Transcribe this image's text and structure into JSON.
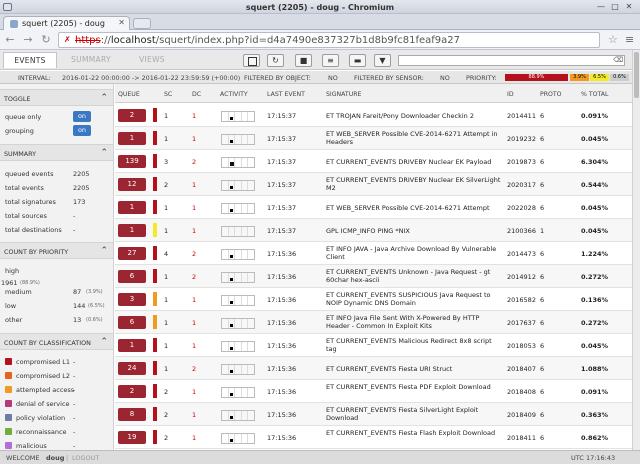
{
  "window": {
    "title": "squert (2205) - doug - Chromium"
  },
  "browser": {
    "tab_title": "squert (2205) - doug",
    "url_scheme": "https",
    "url_rest": "://",
    "url_host": "localhost",
    "url_path": "/squert/index.php?id=d4a7490e837327b1d8b9fc81feaf9a27"
  },
  "toolbar": {
    "tabs": [
      "EVENTS",
      "SUMMARY",
      "VIEWS"
    ]
  },
  "filterbar": {
    "interval_label": "INTERVAL:",
    "interval_value": "2016-01-22 00:00:00 -> 2016-01-22 23:59:59 (+00:00)",
    "filt_object_label": "FILTERED BY OBJECT:",
    "filt_object_value": "NO",
    "filt_sensor_label": "FILTERED BY SENSOR:",
    "filt_sensor_value": "NO",
    "priority_label": "PRIORITY:",
    "priority": [
      {
        "label": "88.9%",
        "color": "#b3121d"
      },
      {
        "label": "3.9%",
        "color": "#f29a1e"
      },
      {
        "label": "6.5%",
        "color": "#f3ea2a"
      },
      {
        "label": "0.6%",
        "color": "#cccccc"
      }
    ]
  },
  "sidebar": {
    "toggle": {
      "title": "TOGGLE",
      "items": [
        {
          "label": "queue only",
          "state": "on"
        },
        {
          "label": "grouping",
          "state": "on"
        }
      ]
    },
    "summary": {
      "title": "SUMMARY",
      "rows": [
        {
          "label": "queued events",
          "value": "2205"
        },
        {
          "label": "total events",
          "value": "2205"
        },
        {
          "label": "total signatures",
          "value": "173"
        },
        {
          "label": "total sources",
          "value": "-"
        },
        {
          "label": "total destinations",
          "value": "-"
        }
      ]
    },
    "priority": {
      "title": "COUNT BY PRIORITY",
      "high_label": "high",
      "high_value": "1961",
      "high_pct": "(88.9%)",
      "rows": [
        {
          "label": "medium",
          "value": "87",
          "pct": "(3.9%)"
        },
        {
          "label": "low",
          "value": "144",
          "pct": "(6.5%)"
        },
        {
          "label": "other",
          "value": "13",
          "pct": "(0.6%)"
        }
      ]
    },
    "classification": {
      "title": "COUNT BY CLASSIFICATION",
      "items": [
        {
          "label": "compromised L1",
          "value": "-",
          "color": "#b3121d"
        },
        {
          "label": "compromised L2",
          "value": "-",
          "color": "#e3651a"
        },
        {
          "label": "attempted access",
          "value": "-",
          "color": "#f29a1e"
        },
        {
          "label": "denial of service",
          "value": "-",
          "color": "#b43a7b"
        },
        {
          "label": "policy violation",
          "value": "-",
          "color": "#6e7aa8"
        },
        {
          "label": "reconnaissance",
          "value": "-",
          "color": "#6fae3a"
        },
        {
          "label": "malicious",
          "value": "-",
          "color": "#b36fd3"
        }
      ]
    }
  },
  "grid": {
    "columns": [
      "QUEUE",
      "SC",
      "DC",
      "ACTIVITY",
      "LAST EVENT",
      "SIGNATURE",
      "ID",
      "PROTO",
      "% TOTAL"
    ],
    "rows": [
      {
        "queue": "2",
        "sc": "1",
        "dc": "1",
        "last": "17:15:37",
        "sig": "ET TROJAN Fareit/Pony Downloader Checkin 2",
        "id": "2014411",
        "proto": "6",
        "pct": "0.091%",
        "color": "#b3121d"
      },
      {
        "queue": "1",
        "sc": "1",
        "dc": "1",
        "last": "17:15:37",
        "sig": "ET WEB_SERVER Possible CVE-2014-6271 Attempt in Headers",
        "id": "2019232",
        "proto": "6",
        "pct": "0.045%",
        "color": "#b3121d"
      },
      {
        "queue": "139",
        "sc": "3",
        "dc": "2",
        "last": "17:15:37",
        "sig": "ET CURRENT_EVENTS DRIVEBY Nuclear EK Payload",
        "id": "2019873",
        "proto": "6",
        "pct": "6.304%",
        "color": "#b3121d"
      },
      {
        "queue": "12",
        "sc": "2",
        "dc": "1",
        "last": "17:15:37",
        "sig": "ET CURRENT_EVENTS DRIVEBY Nuclear EK SilverLight M2",
        "id": "2020317",
        "proto": "6",
        "pct": "0.544%",
        "color": "#b3121d"
      },
      {
        "queue": "1",
        "sc": "1",
        "dc": "1",
        "last": "17:15:37",
        "sig": "ET WEB_SERVER Possible CVE-2014-6271 Attempt",
        "id": "2022028",
        "proto": "6",
        "pct": "0.045%",
        "color": "#b3121d"
      },
      {
        "queue": "1",
        "sc": "1",
        "dc": "1",
        "last": "17:15:37",
        "sig": "GPL ICMP_INFO PING *NIX",
        "id": "2100366",
        "proto": "1",
        "pct": "0.045%",
        "color": "#f3ea2a"
      },
      {
        "queue": "27",
        "sc": "4",
        "dc": "2",
        "last": "17:15:36",
        "sig": "ET INFO JAVA - Java Archive Download By Vulnerable Client",
        "id": "2014473",
        "proto": "6",
        "pct": "1.224%",
        "color": "#b3121d"
      },
      {
        "queue": "6",
        "sc": "1",
        "dc": "2",
        "last": "17:15:36",
        "sig": "ET CURRENT_EVENTS Unknown - Java Request - gt 60char hex-ascii",
        "id": "2014912",
        "proto": "6",
        "pct": "0.272%",
        "color": "#b3121d"
      },
      {
        "queue": "3",
        "sc": "1",
        "dc": "1",
        "last": "17:15:36",
        "sig": "ET CURRENT_EVENTS SUSPICIOUS Java Request to NOIP Dynamic DNS Domain",
        "id": "2016582",
        "proto": "6",
        "pct": "0.136%",
        "color": "#f29a1e"
      },
      {
        "queue": "6",
        "sc": "1",
        "dc": "1",
        "last": "17:15:36",
        "sig": "ET INFO Java File Sent With X-Powered By HTTP Header - Common In Exploit Kits",
        "id": "2017637",
        "proto": "6",
        "pct": "0.272%",
        "color": "#f29a1e"
      },
      {
        "queue": "1",
        "sc": "1",
        "dc": "1",
        "last": "17:15:36",
        "sig": "ET CURRENT_EVENTS Malicious Redirect 8x8 script tag",
        "id": "2018053",
        "proto": "6",
        "pct": "0.045%",
        "color": "#b3121d"
      },
      {
        "queue": "24",
        "sc": "1",
        "dc": "2",
        "last": "17:15:36",
        "sig": "ET CURRENT_EVENTS Fiesta URI Struct",
        "id": "2018407",
        "proto": "6",
        "pct": "1.088%",
        "color": "#b3121d"
      },
      {
        "queue": "2",
        "sc": "2",
        "dc": "1",
        "last": "17:15:36",
        "sig": "ET CURRENT_EVENTS Fiesta PDF Exploit Download",
        "id": "2018408",
        "proto": "6",
        "pct": "0.091%",
        "color": "#b3121d"
      },
      {
        "queue": "8",
        "sc": "2",
        "dc": "1",
        "last": "17:15:36",
        "sig": "ET CURRENT_EVENTS Fiesta SilverLight Exploit Download",
        "id": "2018409",
        "proto": "6",
        "pct": "0.363%",
        "color": "#b3121d"
      },
      {
        "queue": "19",
        "sc": "2",
        "dc": "1",
        "last": "17:15:36",
        "sig": "ET CURRENT_EVENTS Fiesta Flash Exploit Download",
        "id": "2018411",
        "proto": "6",
        "pct": "0.862%",
        "color": "#b3121d"
      }
    ]
  },
  "statusbar": {
    "welcome": "WELCOME",
    "user": "doug",
    "sep": "|",
    "logout": "LOGOUT",
    "clock": "UTC 17:16:43"
  }
}
